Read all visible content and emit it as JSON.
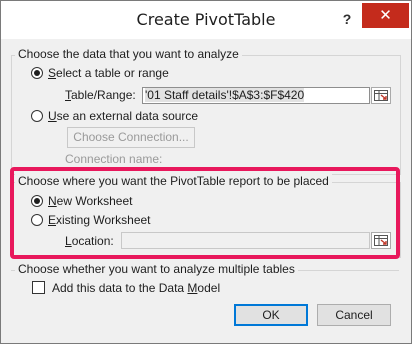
{
  "window": {
    "title": "Create PivotTable",
    "help_label": "?",
    "close_label": "✕"
  },
  "section_analyze": {
    "legend": "Choose the data that you want to analyze",
    "option_select_prefix": "S",
    "option_select_rest": "elect a table or range",
    "table_range_label_u": "T",
    "table_range_label_rest": "able/Range:",
    "table_range_value": "'01 Staff details'!$A$3:$F$420",
    "option_external_prefix": "U",
    "option_external_rest": "se an external data source",
    "choose_connection_label": "Choose Connection...",
    "connection_name_label": "Connection name:"
  },
  "section_placement": {
    "legend": "Choose where you want the PivotTable report to be placed",
    "option_new_prefix": "N",
    "option_new_rest": "ew Worksheet",
    "option_existing_prefix": "E",
    "option_existing_rest": "xisting Worksheet",
    "location_label_u": "L",
    "location_label_rest": "ocation:",
    "location_value": ""
  },
  "section_multiple": {
    "legend": "Choose whether you want to analyze multiple tables",
    "data_model_prefix": "Add this data to the Data ",
    "data_model_u": "M",
    "data_model_rest": "odel",
    "data_model_checked": false
  },
  "buttons": {
    "ok_label": "OK",
    "cancel_label": "Cancel"
  },
  "colors": {
    "highlight": "#e8185c",
    "close_button": "#c42b1c"
  }
}
